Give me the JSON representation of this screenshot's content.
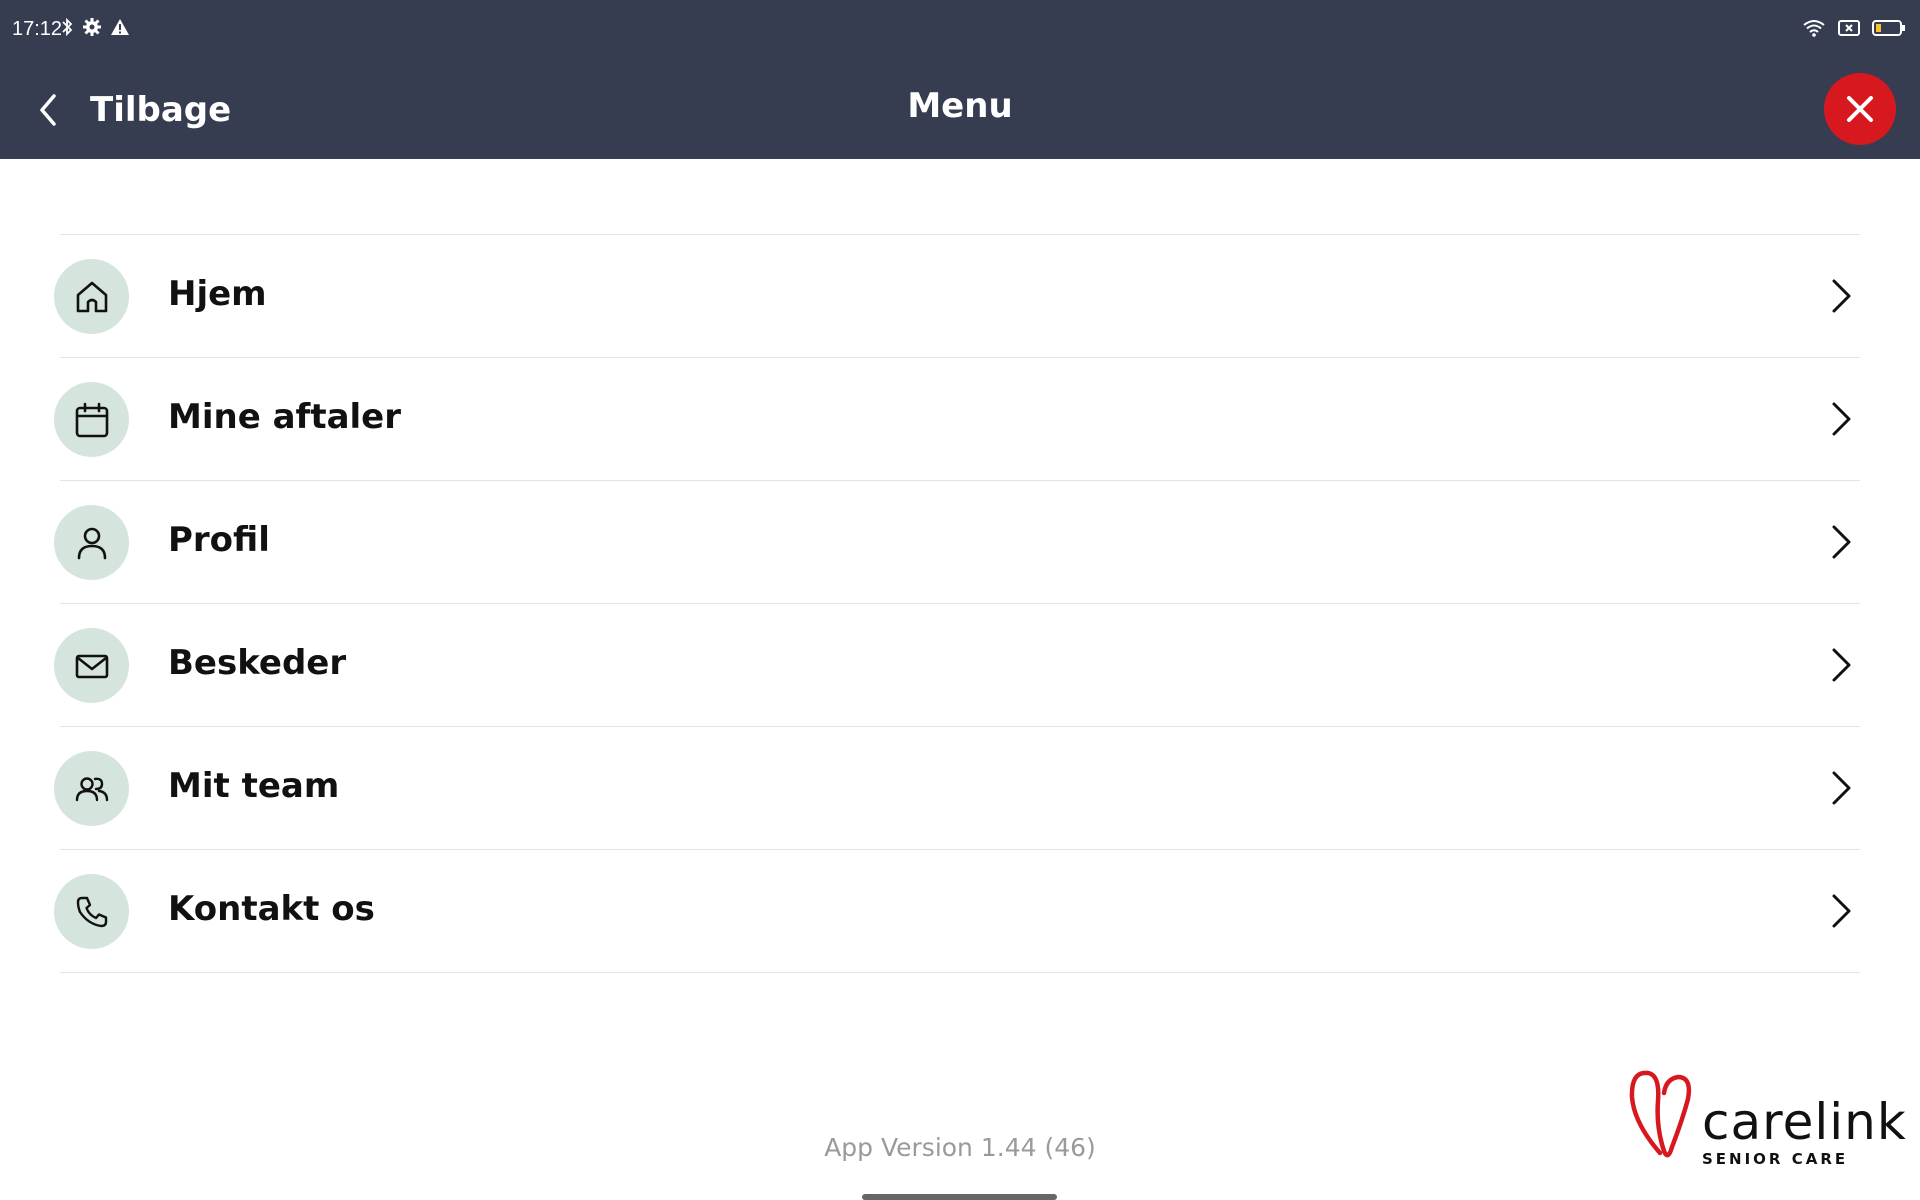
{
  "status_bar": {
    "time": "17:12",
    "left_icons": [
      "bluetooth-icon",
      "settings-icon",
      "warning-icon"
    ],
    "right_icons": [
      "wifi-icon",
      "sim-icon",
      "battery-icon"
    ]
  },
  "header": {
    "back_label": "Tilbage",
    "title": "Menu",
    "close_icon": "close-icon",
    "background": "#363d51",
    "close_color": "#d7191f"
  },
  "menu": {
    "items": [
      {
        "label": "Hjem",
        "icon": "home-icon"
      },
      {
        "label": "Mine aftaler",
        "icon": "calendar-icon"
      },
      {
        "label": "Profil",
        "icon": "user-icon"
      },
      {
        "label": "Beskeder",
        "icon": "mail-icon"
      },
      {
        "label": "Mit team",
        "icon": "team-icon"
      },
      {
        "label": "Kontakt os",
        "icon": "phone-icon"
      }
    ],
    "icon_background": "#d5e4dd"
  },
  "footer": {
    "version": "App Version 1.44 (46)",
    "logo_word": "carelink",
    "logo_sub": "SENIOR CARE"
  }
}
